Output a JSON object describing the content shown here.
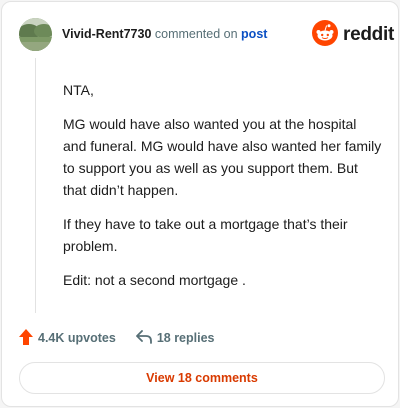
{
  "comment": {
    "username": "Vivid-Rent7730",
    "action_text": " commented on ",
    "post_link": "post",
    "body": [
      "NTA,",
      "MG would have also wanted you at the hospital and funeral. MG would have also wanted her family to support you as well as you support them. But that didn’t happen.",
      "If they have to take out a mortgage that’s their problem.",
      "Edit: not a second mortgage ."
    ]
  },
  "brand": {
    "name": "reddit",
    "icon": "reddit-alien-icon",
    "color": "#ff4500"
  },
  "stats": {
    "upvotes": "4.4K upvotes",
    "upvote_icon": "upvote-arrow-icon",
    "replies": "18 replies",
    "reply_icon": "reply-arrow-icon"
  },
  "footer": {
    "view_comments": "View 18 comments"
  },
  "colors": {
    "accent": "#d93a00",
    "link": "#0b50c4",
    "upvote": "#ff4500",
    "muted": "#576f76"
  }
}
